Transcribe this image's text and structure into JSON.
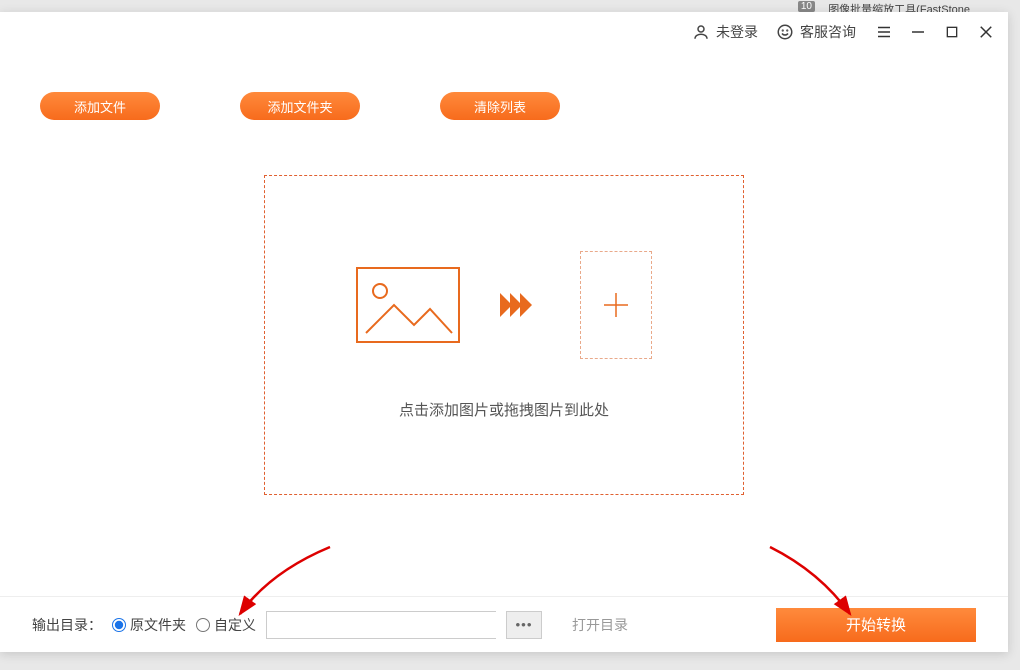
{
  "background": {
    "badge": "10",
    "title": "图像批量缩放工具(FastStone"
  },
  "titlebar": {
    "login": "未登录",
    "support": "客服咨询"
  },
  "toolbar": {
    "add_file": "添加文件",
    "add_folder": "添加文件夹",
    "clear_list": "清除列表"
  },
  "dropzone": {
    "hint": "点击添加图片或拖拽图片到此处"
  },
  "bottombar": {
    "label": "输出目录：",
    "option_original": "原文件夹",
    "option_custom": "自定义",
    "browse": "•••",
    "open_dir": "打开目录",
    "start": "开始转换"
  }
}
